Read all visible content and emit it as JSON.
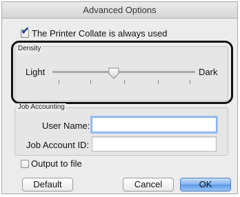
{
  "dialog": {
    "title": "Advanced Options"
  },
  "collate": {
    "label": "The Printer Collate is always used",
    "checked": true
  },
  "density": {
    "group_label": "Density",
    "left_label": "Light",
    "right_label": "Dark",
    "slider_level": 0.43
  },
  "job_accounting": {
    "group_label": "Job Accounting",
    "user_name_label": "User Name:",
    "user_name_value": "",
    "job_account_id_label": "Job Account ID:",
    "job_account_id_value": ""
  },
  "output_to_file": {
    "label": "Output to file",
    "checked": false
  },
  "buttons": {
    "default": "Default",
    "cancel": "Cancel",
    "ok": "OK"
  },
  "colors": {
    "highlight_ring": "#111111",
    "focus_ring": "#9cc2f4",
    "primary_button": "#6aa6ee"
  }
}
